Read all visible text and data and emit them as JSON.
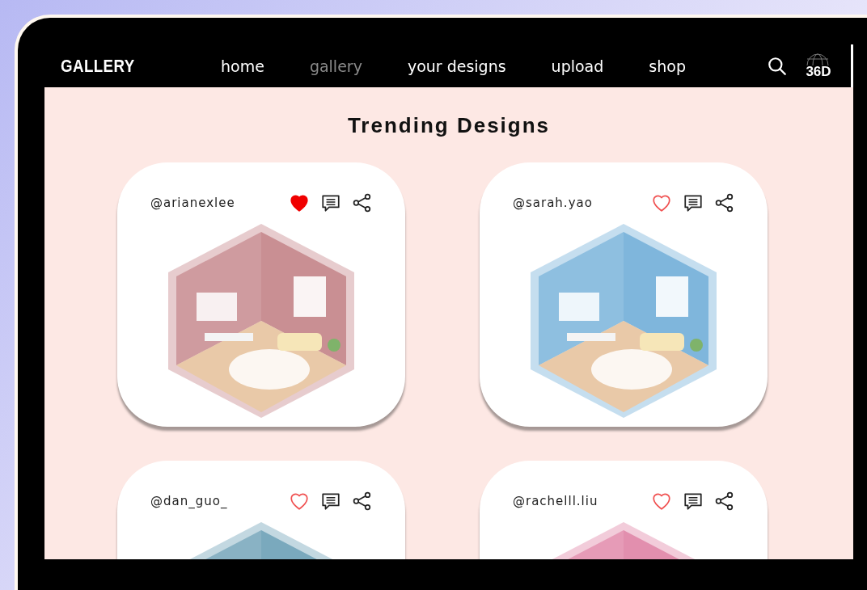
{
  "nav": {
    "brand": "GALLERY",
    "links": [
      {
        "label": "home",
        "selected": false
      },
      {
        "label": "gallery",
        "selected": true
      },
      {
        "label": "your designs",
        "selected": false
      },
      {
        "label": "upload",
        "selected": false
      },
      {
        "label": "shop",
        "selected": false
      }
    ],
    "badge": "36D"
  },
  "heading": "Trending Designs",
  "designs": [
    {
      "user": "@arianexlee",
      "liked": true,
      "color": "#c98f93"
    },
    {
      "user": "@sarah.yao",
      "liked": false,
      "color": "#7fb6dc"
    },
    {
      "user": "@dan_guo_",
      "liked": false,
      "color": "#7aa9bd"
    },
    {
      "user": "@rachelll.liu",
      "liked": false,
      "color": "#e28fae"
    }
  ]
}
